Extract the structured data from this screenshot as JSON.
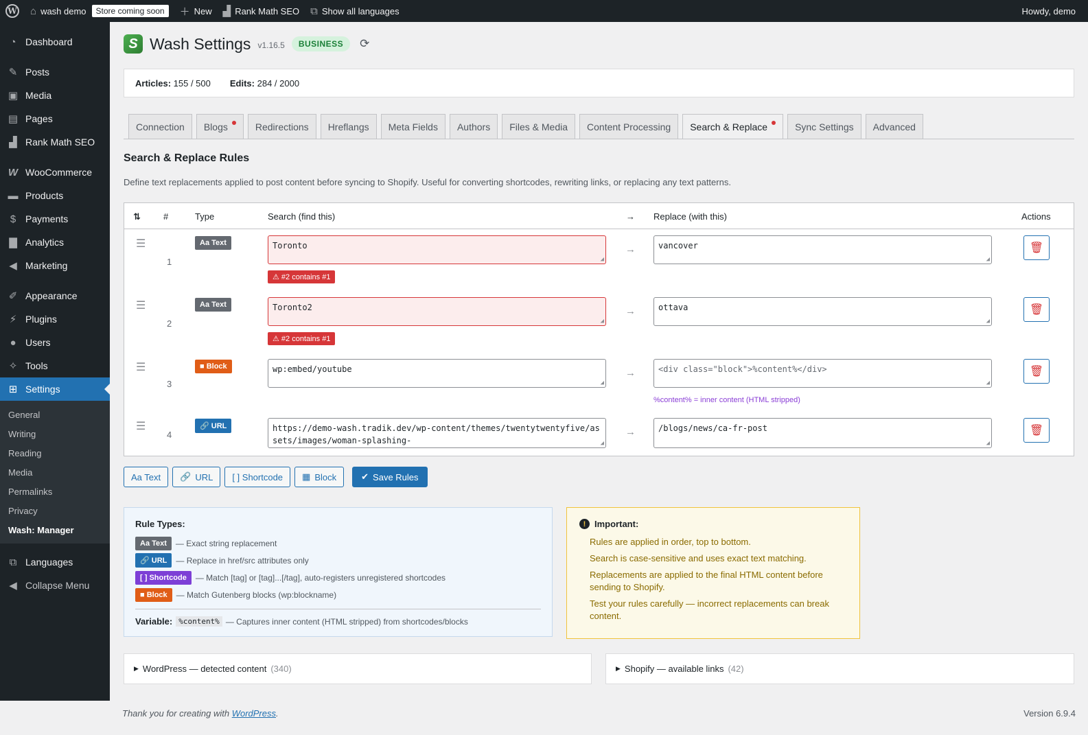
{
  "adminbar": {
    "site_name": "wash demo",
    "store_badge": "Store coming soon",
    "new_label": "New",
    "rankmath_label": "Rank Math SEO",
    "languages_label": "Show all languages",
    "howdy": "Howdy, demo"
  },
  "sidebar": {
    "items": [
      {
        "label": "Dashboard",
        "icon": "dashboard-icon"
      },
      {
        "label": "Posts",
        "icon": "pin-icon"
      },
      {
        "label": "Media",
        "icon": "media-icon"
      },
      {
        "label": "Pages",
        "icon": "pages-icon"
      },
      {
        "label": "Rank Math SEO",
        "icon": "chart-icon"
      },
      {
        "label": "WooCommerce",
        "icon": "woo-icon"
      },
      {
        "label": "Products",
        "icon": "archive-icon"
      },
      {
        "label": "Payments",
        "icon": "dollar-icon"
      },
      {
        "label": "Analytics",
        "icon": "bar-chart-icon"
      },
      {
        "label": "Marketing",
        "icon": "megaphone-icon"
      },
      {
        "label": "Appearance",
        "icon": "brush-icon"
      },
      {
        "label": "Plugins",
        "icon": "plug-icon"
      },
      {
        "label": "Users",
        "icon": "user-icon"
      },
      {
        "label": "Tools",
        "icon": "wrench-icon"
      },
      {
        "label": "Settings",
        "icon": "settings-icon"
      }
    ],
    "submenu": [
      "General",
      "Writing",
      "Reading",
      "Media",
      "Permalinks",
      "Privacy",
      "Wash: Manager"
    ],
    "languages": "Languages",
    "collapse": "Collapse Menu"
  },
  "header": {
    "logo_letter": "S",
    "title": "Wash Settings",
    "version": "v1.16.5",
    "badge": "BUSINESS"
  },
  "stats": {
    "articles_label": "Articles:",
    "articles_value": "155 / 500",
    "edits_label": "Edits:",
    "edits_value": "284 / 2000"
  },
  "tabs": [
    {
      "label": "Connection",
      "dot": false,
      "active": false
    },
    {
      "label": "Blogs",
      "dot": true,
      "active": false
    },
    {
      "label": "Redirections",
      "dot": false,
      "active": false
    },
    {
      "label": "Hreflangs",
      "dot": false,
      "active": false
    },
    {
      "label": "Meta Fields",
      "dot": false,
      "active": false
    },
    {
      "label": "Authors",
      "dot": false,
      "active": false
    },
    {
      "label": "Files & Media",
      "dot": false,
      "active": false
    },
    {
      "label": "Content Processing",
      "dot": false,
      "active": false
    },
    {
      "label": "Search & Replace",
      "dot": true,
      "active": true
    },
    {
      "label": "Sync Settings",
      "dot": false,
      "active": false
    },
    {
      "label": "Advanced",
      "dot": false,
      "active": false
    }
  ],
  "section": {
    "title": "Search & Replace Rules",
    "description": "Define text replacements applied to post content before syncing to Shopify. Useful for converting shortcodes, rewriting links, or replacing any text patterns."
  },
  "table": {
    "headers": {
      "sort": "⇅",
      "num": "#",
      "type": "Type",
      "search": "Search (find this)",
      "arrow": "→",
      "replace": "Replace (with this)",
      "actions": "Actions"
    },
    "rows": [
      {
        "num": "1",
        "type": "Aa Text",
        "search": "Toronto",
        "replace": "vancover",
        "warning": "⚠ #2 contains #1",
        "hint": ""
      },
      {
        "num": "2",
        "type": "Aa Text",
        "search": "Toronto2",
        "replace": "ottava",
        "warning": "⚠ #2 contains #1",
        "hint": ""
      },
      {
        "num": "3",
        "type": "■ Block",
        "search": "wp:embed/youtube",
        "replace": "<div class=\"block\">%content%</div>",
        "warning": "",
        "hint": "%content% = inner content (HTML stripped)"
      },
      {
        "num": "4",
        "type": "🔗 URL",
        "search": "https://demo-wash.tradik.dev/wp-content/themes/twentytwentyfive/assets/images/woman-splashing-",
        "replace": "/blogs/news/ca-fr-post",
        "warning": "",
        "hint": ""
      }
    ]
  },
  "buttons": {
    "add_text": "Aa Text",
    "add_url": "URL",
    "add_shortcode": "[ ] Shortcode",
    "add_block": "Block",
    "save": "Save Rules"
  },
  "rule_types": {
    "title": "Rule Types:",
    "items": [
      {
        "badge": "Aa Text",
        "desc": "— Exact string replacement"
      },
      {
        "badge": "🔗 URL",
        "desc": "— Replace in href/src attributes only"
      },
      {
        "badge": "[ ] Shortcode",
        "desc": "— Match [tag] or [tag]...[/tag], auto-registers unregistered shortcodes"
      },
      {
        "badge": "■ Block",
        "desc": "— Match Gutenberg blocks (wp:blockname)"
      }
    ],
    "variable_label": "Variable:",
    "variable_code": "%content%",
    "variable_desc": "— Captures inner content (HTML stripped) from shortcodes/blocks"
  },
  "important": {
    "title": "Important:",
    "items": [
      "Rules are applied in order, top to bottom.",
      "Search is case-sensitive and uses exact text matching.",
      "Replacements are applied to the final HTML content before sending to Shopify.",
      "Test your rules carefully — incorrect replacements can break content."
    ]
  },
  "collapsibles": {
    "wordpress_label": "WordPress — detected content",
    "wordpress_count": "(340)",
    "shopify_label": "Shopify — available links",
    "shopify_count": "(42)"
  },
  "footer": {
    "thanks_prefix": "Thank you for creating with",
    "wordpress_link": "WordPress",
    "thanks_suffix": ".",
    "version": "Version 6.9.4"
  },
  "colors": {
    "sidebar_bg": "#1d2327",
    "accent": "#2271b1",
    "error": "#d63638",
    "block_orange": "#e05d17",
    "shortcode_purple": "#7d3fd6"
  }
}
